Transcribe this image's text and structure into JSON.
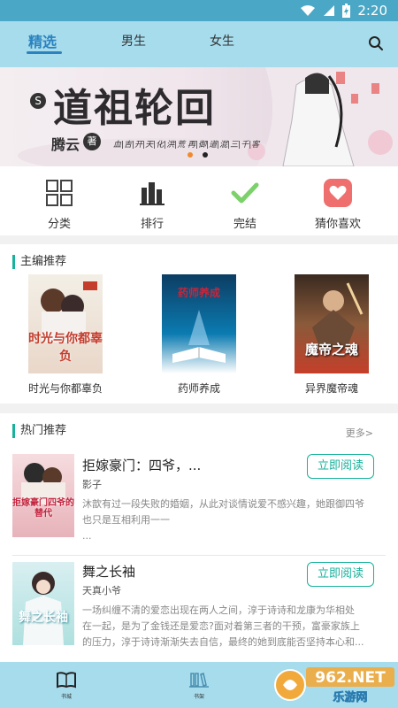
{
  "status": {
    "time": "2:20"
  },
  "tabs": [
    {
      "label": "精选",
      "active": true
    },
    {
      "label": "男生",
      "active": false
    },
    {
      "label": "女生",
      "active": false
    }
  ],
  "banner": {
    "title": "道祖轮回",
    "author": "腾云",
    "author_suffix": "著",
    "tagline": "血|吉|开|天|化|洪|荒  再|御|道|混|三|千|客",
    "slides": 2,
    "active_slide": 0
  },
  "quick_actions": [
    {
      "label": "分类",
      "icon": "grid-icon"
    },
    {
      "label": "排行",
      "icon": "bar-chart-icon"
    },
    {
      "label": "完结",
      "icon": "check-icon"
    },
    {
      "label": "猜你喜欢",
      "icon": "heart-icon"
    }
  ],
  "editor_picks": {
    "heading": "主编推荐",
    "books": [
      {
        "title": "时光与你都辜负",
        "cover_text": "时光与你都辜负",
        "accent": "#c33c2c"
      },
      {
        "title": "药师养成",
        "cover_text": "药师养成",
        "accent": "#c8253a"
      },
      {
        "title": "异界魔帝魂",
        "cover_text": "魔帝之魂",
        "accent": "#ffffff"
      }
    ]
  },
  "hot": {
    "heading": "热门推荐",
    "more": "更多>",
    "items": [
      {
        "title": "拒嫁豪门：四爷，...",
        "author": "影子",
        "desc1": "沐歆有过一段失败的婚姻，从此对谈情说爱不感兴趣，她跟御四爷",
        "desc2": "也只是互相利用一一",
        "desc3": "...",
        "cover_text": "拒嫁豪门四爷的替代",
        "button": "立即阅读"
      },
      {
        "title": "舞之长袖",
        "author": "天真小爷",
        "desc1": "一场纠缠不清的爱恋出现在两人之间，淳于诗诗和龙康为华相处",
        "desc2": "在一起，是为了金钱还是爱恋?面对着第三者的干预，富豪家族上",
        "desc3": "的压力，淳于诗诗渐渐失去自信，最终的她到底能否坚持本心和...",
        "cover_text": "舞之长袖",
        "button": "立即阅读"
      }
    ]
  },
  "bottom_nav": [
    {
      "label": "书城"
    },
    {
      "label": "书架"
    }
  ],
  "watermark": {
    "brand": "962.NET",
    "sub": "乐游网"
  },
  "colors": {
    "accent": "#16b29c",
    "tab_active": "#2c82bf",
    "bar": "#a6dcec",
    "status": "#4aa7c5"
  }
}
